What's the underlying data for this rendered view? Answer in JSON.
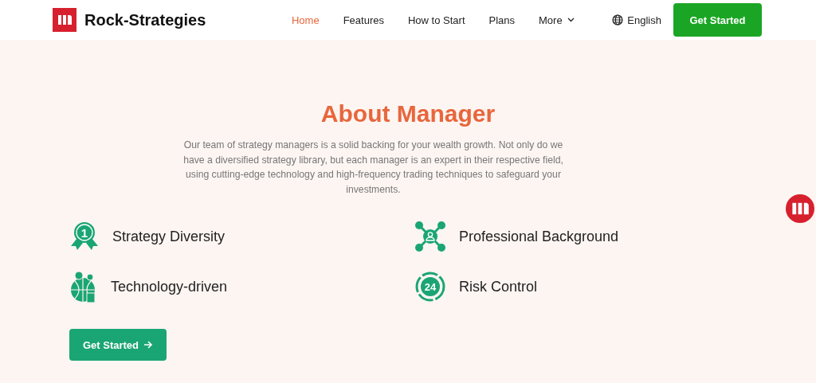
{
  "header": {
    "brand": "Rock-Strategies",
    "nav": [
      {
        "label": "Home",
        "selected": true
      },
      {
        "label": "Features",
        "selected": false
      },
      {
        "label": "How to Start",
        "selected": false
      },
      {
        "label": "Plans",
        "selected": false
      },
      {
        "label": "More",
        "selected": false,
        "dropdown": true
      }
    ],
    "language": "English",
    "cta": "Get Started"
  },
  "about": {
    "title": "About Manager",
    "description": "Our team of strategy managers is a solid backing for your wealth growth. Not only do we have a diversified strategy library, but each manager is an expert in their respective field, using cutting-edge technology and high-frequency trading techniques to safeguard your investments.",
    "features": [
      {
        "kind": "medal",
        "icon_text": "1",
        "label": "Strategy Diversity"
      },
      {
        "kind": "network",
        "label": "Professional Background"
      },
      {
        "kind": "globe",
        "label": "Technology-driven"
      },
      {
        "kind": "clock",
        "icon_text": "24",
        "label": "Risk Control"
      }
    ],
    "button": "Get Started"
  }
}
